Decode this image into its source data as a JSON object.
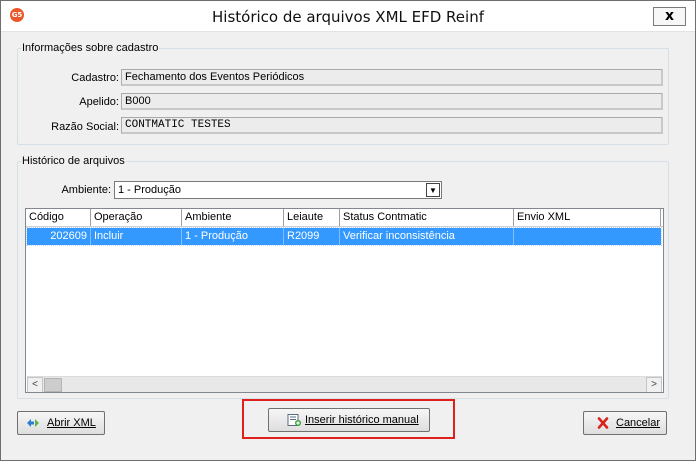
{
  "window": {
    "title": "Histórico de arquivos XML EFD Reinf",
    "app_icon_text": "G5",
    "close_label": "x"
  },
  "cadastro_group": {
    "legend": "Informações sobre cadastro",
    "cadastro_label": "Cadastro:",
    "cadastro_value": "Fechamento dos Eventos Periódicos",
    "apelido_label": "Apelido:",
    "apelido_value": "B000",
    "razao_label": "Razão Social:",
    "razao_value": "CONTMATIC TESTES"
  },
  "historico_group": {
    "legend": "Histórico de arquivos",
    "ambiente_label": "Ambiente:",
    "ambiente_selected": "1 - Produção",
    "columns": [
      "Código",
      "Operação",
      "Ambiente",
      "Leiaute",
      "Status Contmatic",
      "Envio XML"
    ],
    "rows": [
      {
        "codigo": "202609",
        "operacao": "Incluir",
        "ambiente": "1 - Produção",
        "leiaute": "R2099",
        "status": "Verificar inconsistência",
        "envio": ""
      }
    ]
  },
  "buttons": {
    "abrir_xml": "Abrir XML",
    "inserir_historico": "Inserir histórico manual",
    "cancelar": "Cancelar"
  },
  "icons": {
    "app": "g5-app-icon",
    "abrir": "xml-arrows-icon",
    "inserir": "document-add-icon",
    "cancelar": "red-x-icon"
  },
  "colors": {
    "selection": "#3399ff",
    "highlight_box": "#e0201c",
    "app_icon": "#e8582b"
  }
}
